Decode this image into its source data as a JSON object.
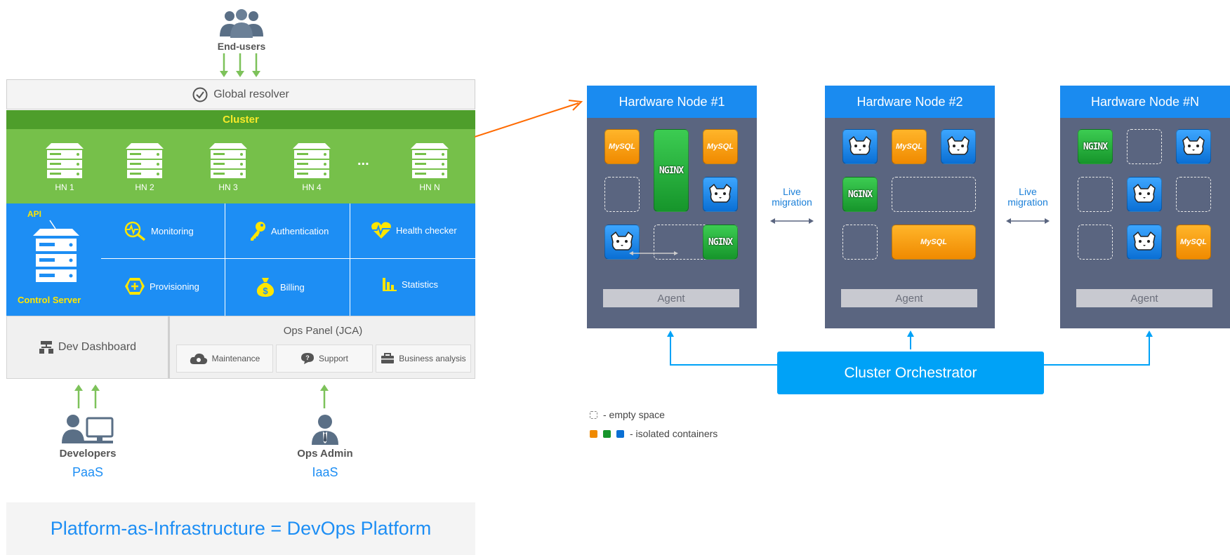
{
  "left": {
    "end_users": "End-users",
    "global_resolver": "Global resolver",
    "cluster": "Cluster",
    "hardware_nodes": [
      "HN 1",
      "HN 2",
      "HN 3",
      "HN 4",
      "HN N"
    ],
    "hn_ellipsis": "...",
    "api": "API",
    "control_server": "Control Server",
    "services": {
      "monitoring": "Monitoring",
      "authentication": "Authentication",
      "health_checker": "Health checker",
      "provisioning": "Provisioning",
      "billing": "Billing",
      "statistics": "Statistics"
    },
    "dev_dashboard": "Dev Dashboard",
    "ops_panel": {
      "title": "Ops Panel (JCA)",
      "buttons": [
        "Maintenance",
        "Support",
        "Business analysis"
      ]
    },
    "developers": {
      "name": "Developers",
      "type": "PaaS"
    },
    "ops_admin": {
      "name": "Ops Admin",
      "type": "IaaS"
    },
    "footer": "Platform-as-Infrastructure = DevOps Platform"
  },
  "right": {
    "nodes": [
      {
        "title": "Hardware Node #1",
        "agent": "Agent"
      },
      {
        "title": "Hardware Node #2",
        "agent": "Agent"
      },
      {
        "title": "Hardware Node #N",
        "agent": "Agent"
      }
    ],
    "migration_labels": [
      "Live\nmigration",
      "Live\nmigration"
    ],
    "orchestrator": "Cluster Orchestrator",
    "legend": {
      "empty": "- empty space",
      "isolated": "- isolated containers"
    },
    "container_logos": {
      "mysql": "MySQL",
      "nginx": "NGINX"
    }
  },
  "colors": {
    "blue": "#1d8ef4",
    "green": "#76c04a",
    "dark_green": "#4e9e2b",
    "yellow": "#ffe600",
    "node_bg": "#5a6580",
    "orange_container": "#f08a00",
    "green_container": "#16952b",
    "blue_container": "#0a6fd4",
    "orchestrator": "#00a2f7",
    "arrow_green": "#7dc25a",
    "arrow_orange": "#ff6a00"
  },
  "icons": [
    "users-icon",
    "check-circle-icon",
    "server-icon",
    "monitoring-icon",
    "key-icon",
    "heart-pulse-icon",
    "hexagon-plus-icon",
    "money-bag-icon",
    "bar-chart-icon",
    "sitemap-icon",
    "cloud-wrench-icon",
    "chat-question-icon",
    "briefcase-icon",
    "developer-desk-icon",
    "admin-user-icon",
    "tomcat-icon",
    "mysql-icon",
    "nginx-icon"
  ]
}
